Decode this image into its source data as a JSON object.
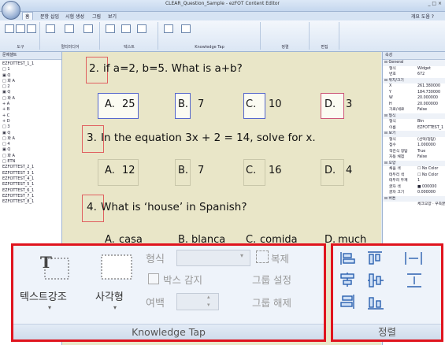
{
  "window": {
    "title": "CLEAR_Question_Sample - ezFOT Content Editor",
    "controls": "_ □ ×"
  },
  "tabs": [
    {
      "label": "홈",
      "active": true
    },
    {
      "label": "문항 삽입",
      "active": false
    },
    {
      "label": "시험 생성",
      "active": false
    },
    {
      "label": "그림",
      "active": false
    },
    {
      "label": "보기",
      "active": false
    }
  ],
  "help_label": "개요 도움 ?",
  "ribbon_groups": [
    "도구",
    "멀티미디어",
    "텍스트",
    "Knowledge Tap",
    "정렬",
    "편집"
  ],
  "tree": {
    "header": "문제셀트",
    "items": [
      "EZFOTTEST_1_1",
      "□ 1",
      "  ▣ Q",
      "  □ 화 A",
      "□ 2",
      "  ▣ Q",
      "  □ 화 A",
      "    + A",
      "    + B",
      "    + C",
      "    + D",
      "□ 3",
      "  ▣ Q",
      "  □ 화 A",
      "□ 4",
      "  ▣ Q",
      "  □ 화 A",
      "□ ETN",
      "EZFOTTEST_2_1",
      "EZFOTTEST_3_1",
      "EZFOTTEST_4_1",
      "EZFOTTEST_5_1",
      "EZFOTTEST_6_1",
      "EZFOTTEST_7_1",
      "EZFOTTEST_8_1"
    ]
  },
  "props": {
    "header": "속성",
    "rows": [
      {
        "cat": true,
        "k": "⊟ General",
        "v": ""
      },
      {
        "k": "형식",
        "v": "Widget"
      },
      {
        "k": "번호",
        "v": "672"
      },
      {
        "cat": true,
        "k": "⊟ 위치/크기",
        "v": ""
      },
      {
        "k": "X",
        "v": "261.380000"
      },
      {
        "k": "Y",
        "v": "184.730000"
      },
      {
        "k": "W",
        "v": "20.000000"
      },
      {
        "k": "H",
        "v": "20.000000"
      },
      {
        "k": "가로/세로",
        "v": "False"
      },
      {
        "cat": true,
        "k": "⊟ 형식",
        "v": ""
      },
      {
        "k": "형식",
        "v": "Btn"
      },
      {
        "k": "이름",
        "v": "EZFOTTEST_1"
      },
      {
        "cat": true,
        "k": "⊟ 보기",
        "v": ""
      },
      {
        "k": "형식",
        "v": "(선택/정답)"
      },
      {
        "k": "점수",
        "v": "1.000000"
      },
      {
        "k": "객관식 정답",
        "v": "True"
      },
      {
        "k": "자동 채점",
        "v": "False"
      },
      {
        "cat": true,
        "k": "⊟ 모양",
        "v": ""
      },
      {
        "k": "채움 색",
        "v": "☐ No Color"
      },
      {
        "k": "테두리 색",
        "v": "☐ No Color"
      },
      {
        "k": "테두리 두께",
        "v": "1"
      },
      {
        "k": "글자 색",
        "v": "■ 000000"
      },
      {
        "k": "글자 크기",
        "v": "0.000000"
      },
      {
        "cat": true,
        "k": "⊟ 버튼",
        "v": ""
      },
      {
        "k": "",
        "v": "체크모양 · 우측끝 체크"
      }
    ]
  },
  "questions": [
    {
      "num": "2.",
      "text": "if a=2, b=5. What is a+b?",
      "options": [
        {
          "letter": "A.",
          "value": "25"
        },
        {
          "letter": "B.",
          "value": "7"
        },
        {
          "letter": "C.",
          "value": "10"
        },
        {
          "letter": "D.",
          "value": "3"
        }
      ]
    },
    {
      "num": "3.",
      "text": "In the equation 3x + 2 = 14, solve for x.",
      "options": [
        {
          "letter": "A.",
          "value": "12"
        },
        {
          "letter": "B.",
          "value": "7"
        },
        {
          "letter": "C.",
          "value": "16"
        },
        {
          "letter": "D.",
          "value": "4"
        }
      ]
    },
    {
      "num": "4.",
      "text": "What is ‘house’ in Spanish?",
      "options": [
        {
          "letter": "A.",
          "value": "casa"
        },
        {
          "letter": "B.",
          "value": "blanca"
        },
        {
          "letter": "C.",
          "value": "comida"
        },
        {
          "letter": "D.",
          "value": "much"
        }
      ]
    }
  ],
  "knowledge_tap": {
    "text_emphasis": "텍스트강조",
    "rectangle": "사각형",
    "format_label": "형식",
    "copy_label": "복제",
    "box_detect": "박스 감지",
    "group_set": "그룹 설정",
    "margin_label": "여백",
    "group_unset": "그룹 해제",
    "group_name": "Knowledge Tap"
  },
  "align": {
    "group_name": "정렬"
  }
}
